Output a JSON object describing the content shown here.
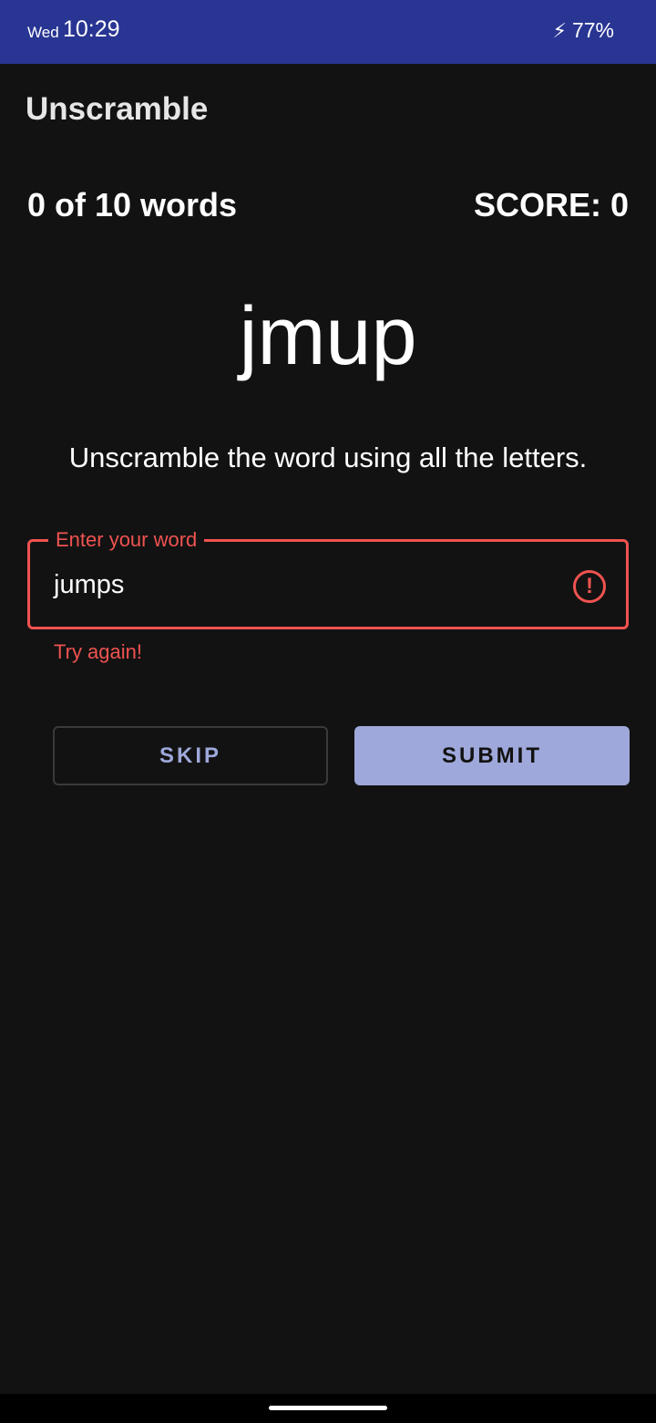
{
  "status_bar": {
    "day": "Wed",
    "time": "10:29",
    "battery": "77%",
    "bolt_icon": "⚡"
  },
  "app": {
    "title": "Unscramble"
  },
  "game": {
    "word_count": "0 of 10 words",
    "score": "SCORE: 0",
    "scrambled_word": "jmup",
    "instructions": "Unscramble the word using all the letters."
  },
  "input": {
    "label": "Enter your word",
    "value": "jumps",
    "error_icon": "!",
    "helper_text": "Try again!"
  },
  "buttons": {
    "skip": "SKIP",
    "submit": "SUBMIT"
  }
}
